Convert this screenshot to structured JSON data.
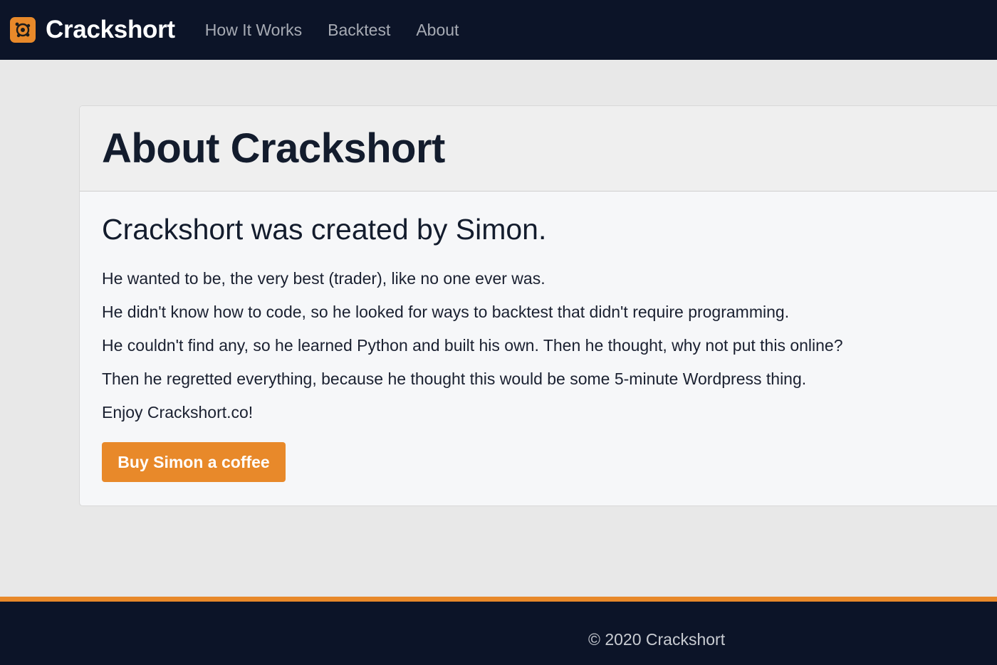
{
  "nav": {
    "brand": "Crackshort",
    "links": [
      "How It Works",
      "Backtest",
      "About"
    ]
  },
  "page": {
    "title": "About Crackshort",
    "subtitle": "Crackshort was created by Simon.",
    "paragraphs": [
      "He wanted to be, the very best (trader), like no one ever was.",
      "He didn't know how to code, so he looked for ways to backtest that didn't require programming.",
      "He couldn't find any, so he learned Python and built his own. Then he thought, why not put this online?",
      "Then he regretted everything, because he thought this would be some 5-minute Wordpress thing.",
      "Enjoy Crackshort.co!"
    ],
    "button_label": "Buy Simon a coffee"
  },
  "footer": {
    "copyright": "© 2020 Crackshort"
  },
  "colors": {
    "navbar_bg": "#0c1428",
    "accent": "#e8892a",
    "page_bg": "#e8e8e8"
  }
}
